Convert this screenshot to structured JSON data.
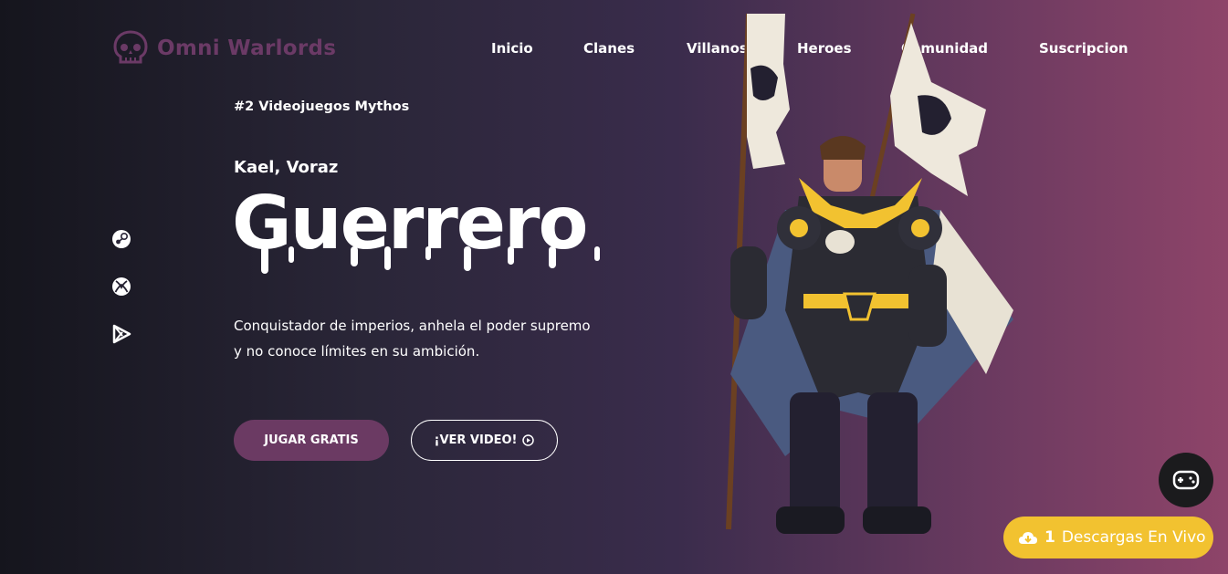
{
  "brand": {
    "name": "Omni Warlords",
    "color": "#6b3a66"
  },
  "nav": [
    {
      "label": "Inicio"
    },
    {
      "label": "Clanes"
    },
    {
      "label": "Villanos"
    },
    {
      "label": "Heroes"
    },
    {
      "label": "Comunidad"
    },
    {
      "label": "Suscripcion"
    }
  ],
  "social": [
    {
      "icon": "steam-icon"
    },
    {
      "icon": "xbox-icon"
    },
    {
      "icon": "google-play-icon"
    }
  ],
  "hero": {
    "tagline": "#2 Videojuegos Mythos",
    "character_name": "Kael, Voraz",
    "title": "Guerrero",
    "description_line1": "Conquistador de imperios, anhela el poder supremo",
    "description_line2": "y no conoce límites en su ambición.",
    "play_button": "JUGAR GRATIS",
    "video_button": "¡VER VIDEO!"
  },
  "live": {
    "count": "1",
    "label": "Descargas En Vivo",
    "icon": "cloud-download-icon",
    "color": "#f2c230"
  },
  "floating": {
    "icon": "gamepad-icon"
  }
}
